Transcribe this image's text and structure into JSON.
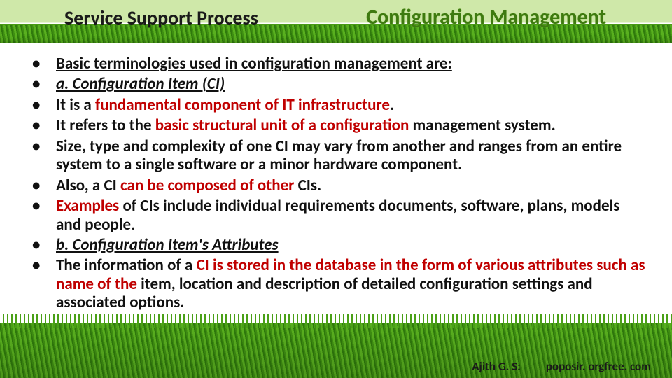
{
  "header": {
    "left": "Service Support Process",
    "right": "Configuration Management"
  },
  "bullets": {
    "b1_u": "Basic terminologies used in configuration management are:",
    "b2_ui": "a. Configuration Item (CI)",
    "b3_a": "It is a ",
    "b3_r": "fundamental component of IT infrastructure",
    "b3_c": ".",
    "b4_a": "It refers to the ",
    "b4_r": "basic structural unit of a configuration ",
    "b4_c": "management system.",
    "b5": "Size, type and complexity of one CI may vary from another and ranges from an entire system to a single software or a minor hardware component.",
    "b6_a": "Also, a CI ",
    "b6_r": "can be composed of other ",
    "b6_c": "CIs.",
    "b7_r": "Examples ",
    "b7_c": "of CIs include individual requirements documents, software, plans, models and people.",
    "b8_ui": "b. Configuration Item's Attributes",
    "b9_a": "The information of a ",
    "b9_r": "CI is stored in the database in the form of various attributes such as name of the ",
    "b9_c": "item, location and description of detailed configuration settings and associated options."
  },
  "footer": {
    "author": "Ajith G. S:",
    "site": "poposir. orgfree. com"
  }
}
